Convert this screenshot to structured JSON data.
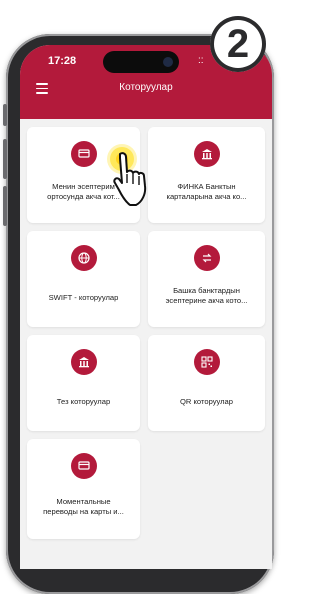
{
  "status_bar": {
    "time": "17:28",
    "indicator": "::"
  },
  "header": {
    "title": "Которуулар",
    "menu_icon": "hamburger-menu-icon"
  },
  "step_marker": {
    "number": "2"
  },
  "tiles": [
    {
      "id": "own-accounts",
      "icon": "transfer-icon",
      "line1": "Менин эсептерим",
      "line2": "ортосунда акча кот..."
    },
    {
      "id": "finca-cards",
      "icon": "bank-icon",
      "line1": "ФИНКА Банктын",
      "line2": "карталарына акча ко..."
    },
    {
      "id": "swift",
      "icon": "globe-swift-icon",
      "line1": "SWIFT - которуулар",
      "line2": ""
    },
    {
      "id": "other-banks",
      "icon": "exchange-arrows-icon",
      "line1": "Башка банктардын",
      "line2": "эсептерине акча кото..."
    },
    {
      "id": "fast",
      "icon": "bank-icon",
      "line1": "Тез которуулар",
      "line2": ""
    },
    {
      "id": "qr",
      "icon": "qr-code-icon",
      "line1": "QR которуулар",
      "line2": ""
    },
    {
      "id": "card-instant",
      "icon": "transfer-icon",
      "line1": "Моментальные",
      "line2": "переводы на карты и..."
    }
  ],
  "colors": {
    "accent": "#b31a3b",
    "background": "#f2f2f2",
    "card": "#ffffff"
  }
}
